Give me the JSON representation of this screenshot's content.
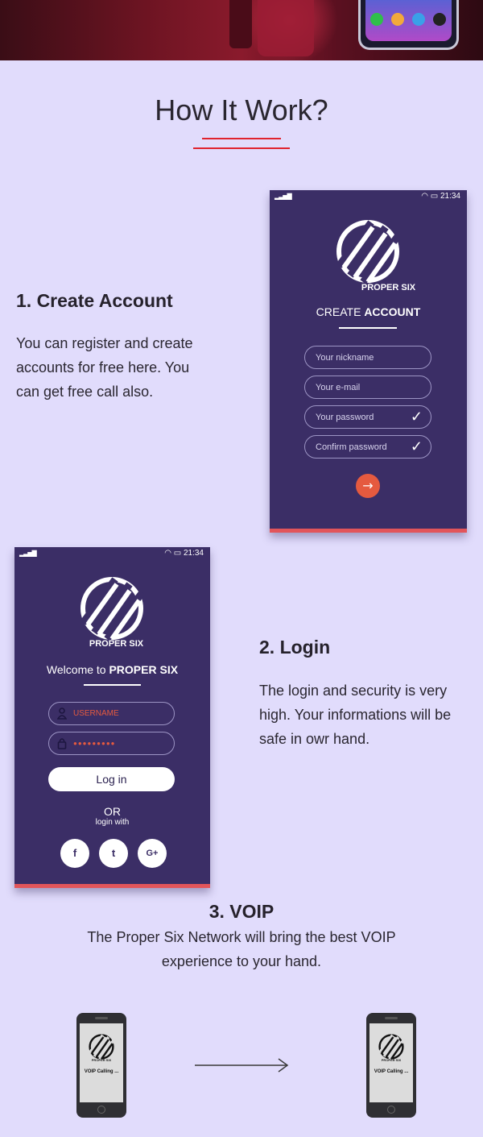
{
  "section": {
    "title": "How It Work?"
  },
  "steps": [
    {
      "heading": "1. Create Account",
      "text_lines": [
        "You can register and create",
        "accounts for free here. You",
        "can get free call also."
      ]
    },
    {
      "heading": "2. Login",
      "text_lines": [
        "The login and security is very",
        "high. Your informations will be",
        "safe in owr hand."
      ]
    }
  ],
  "voip": {
    "heading": "3. VOIP",
    "text_lines": [
      "The Proper Six Network will bring the best VOIP",
      "experience to your hand."
    ]
  },
  "register_screen": {
    "time": "21:34",
    "brand": "PROPER SIX",
    "title_light": "CREATE ",
    "title_bold": "ACCOUNT",
    "fields": [
      {
        "placeholder": "Your nickname",
        "checked": false
      },
      {
        "placeholder": "Your e-mail",
        "checked": false
      },
      {
        "placeholder": "Your password",
        "checked": true
      },
      {
        "placeholder": "Confirm password",
        "checked": true
      }
    ],
    "check_glyph": "✓",
    "submit_glyph": "→"
  },
  "login_screen": {
    "time": "21:34",
    "brand": "PROPER SIX",
    "title_light": "Welcome to ",
    "title_bold": "PROPER SIX",
    "username_placeholder": "USERNAME",
    "password_mask": "●●●●●●●●●",
    "login_label": "Log in",
    "or_label": "OR",
    "login_with_label": "login with",
    "social": [
      "f",
      "t",
      "G+"
    ]
  },
  "voip_phones": {
    "brand": "PROPER SIX",
    "calling_label": "VOIP Calling ..."
  },
  "colors": {
    "background": "#e1dcfc",
    "phone_panel": "#3b2e66",
    "accent_red": "#e0242e",
    "accent_orange": "#e55a3f"
  }
}
